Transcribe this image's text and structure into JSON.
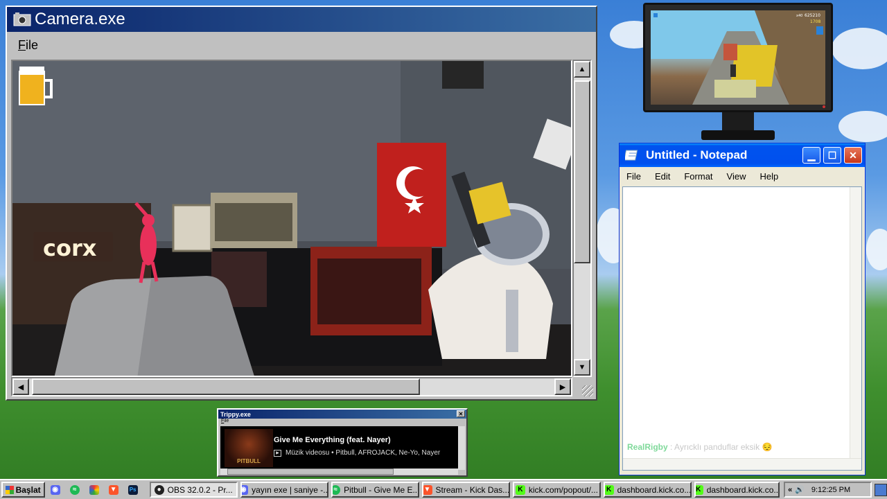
{
  "camera": {
    "title": "Camera.exe",
    "menu_file": "File",
    "sign_text": "corx"
  },
  "monitor": {
    "hud_score": "625210",
    "hud_coins": "1708",
    "hud_multiplier": "x40"
  },
  "notepad": {
    "title": "Untitled - Notepad",
    "menu": [
      "File",
      "Edit",
      "Format",
      "View",
      "Help"
    ],
    "chat_user": "RealRigby",
    "chat_sep": " : ",
    "chat_message": "Ayrıcklı panduflar eksik 😔"
  },
  "trippy": {
    "title": "Trippy.exe",
    "menu_file": "File",
    "track_title": "Give Me Everything (feat. Nayer)",
    "track_meta": "Müzik videosu • Pitbull, AFROJACK, Ne-Yo, Nayer",
    "art_label": "PITBULL"
  },
  "taskbar": {
    "start_label": "Başlat",
    "quick_icons": [
      "discord-icon",
      "spotify-icon",
      "paint-icon",
      "brave-icon",
      "photoshop-icon"
    ],
    "tasks": [
      {
        "label": "OBS 32.0.2 - Pr...",
        "icon": "obs-icon",
        "color": "#222222",
        "active": true
      },
      {
        "label": "yayın exe | saniye -...",
        "icon": "discord-icon",
        "color": "#5865f2",
        "active": false
      },
      {
        "label": "Pitbull - Give Me E...",
        "icon": "spotify-icon",
        "color": "#1db954",
        "active": false
      },
      {
        "label": "Stream - Kick Das...",
        "icon": "brave-icon",
        "color": "#fb542b",
        "active": false
      },
      {
        "label": "kick.com/popout/...",
        "icon": "kick-icon",
        "color": "#53fc18",
        "active": false
      },
      {
        "label": "dashboard.kick.co...",
        "icon": "kick-icon",
        "color": "#53fc18",
        "active": false
      },
      {
        "label": "dashboard.kick.co...",
        "icon": "kick-icon",
        "color": "#53fc18",
        "active": false
      }
    ],
    "clock": "9:12:25 PM",
    "tray_arrows": "«"
  }
}
